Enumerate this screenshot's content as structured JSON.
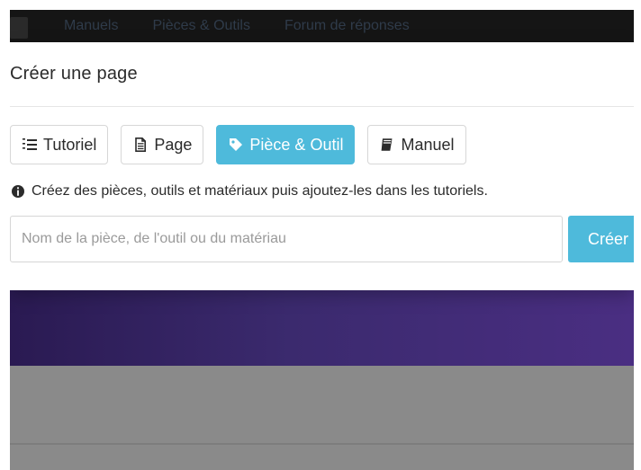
{
  "background": {
    "nav_links": [
      "Manuels",
      "Pièces & Outils",
      "Forum de réponses"
    ]
  },
  "modal": {
    "title": "Créer une page",
    "tabs": [
      {
        "label": "Tutoriel",
        "icon": "list-ordered-icon",
        "active": false
      },
      {
        "label": "Page",
        "icon": "document-icon",
        "active": false
      },
      {
        "label": "Pièce & Outil",
        "icon": "tag-icon",
        "active": true
      },
      {
        "label": "Manuel",
        "icon": "book-icon",
        "active": false
      }
    ],
    "info": {
      "icon": "info-circle-icon",
      "text": "Créez des pièces, outils et matériaux puis ajoutez-les dans les tutoriels."
    },
    "name_input": {
      "value": "",
      "placeholder": "Nom de la pièce, de l'outil ou du matériau"
    },
    "create_label": "Créer"
  },
  "colors": {
    "accent": "#4ebadb",
    "hero_purple": "#3b2a6e"
  }
}
